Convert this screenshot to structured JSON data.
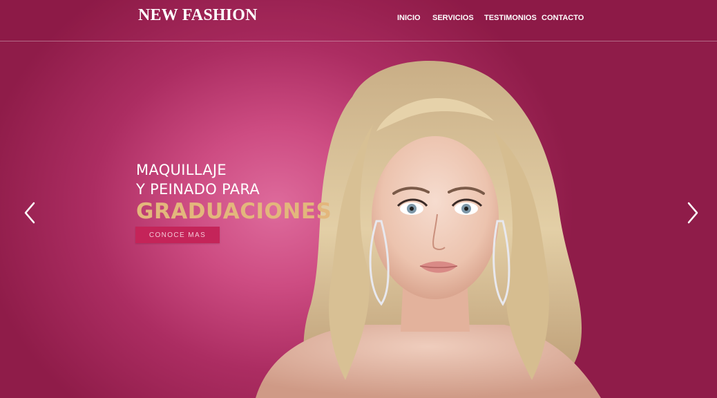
{
  "header": {
    "logo": "NEW FASHION",
    "nav": [
      {
        "label": "INICIO"
      },
      {
        "label": "SERVICIOS"
      },
      {
        "label": "TESTIMONIOS"
      },
      {
        "label": "CONTACTO"
      }
    ]
  },
  "hero": {
    "line1": "MAQUILLAJE",
    "line2": "Y PEINADO PARA",
    "line3": "GRADUACIONES",
    "cta_label": "CONOCE MAS"
  },
  "carousel": {
    "prev_icon": "chevron-left-icon",
    "next_icon": "chevron-right-icon"
  },
  "colors": {
    "background": "#b63467",
    "headline_accent": "#e3b77c",
    "cta_background": "#c42459",
    "text": "#ffffff"
  }
}
